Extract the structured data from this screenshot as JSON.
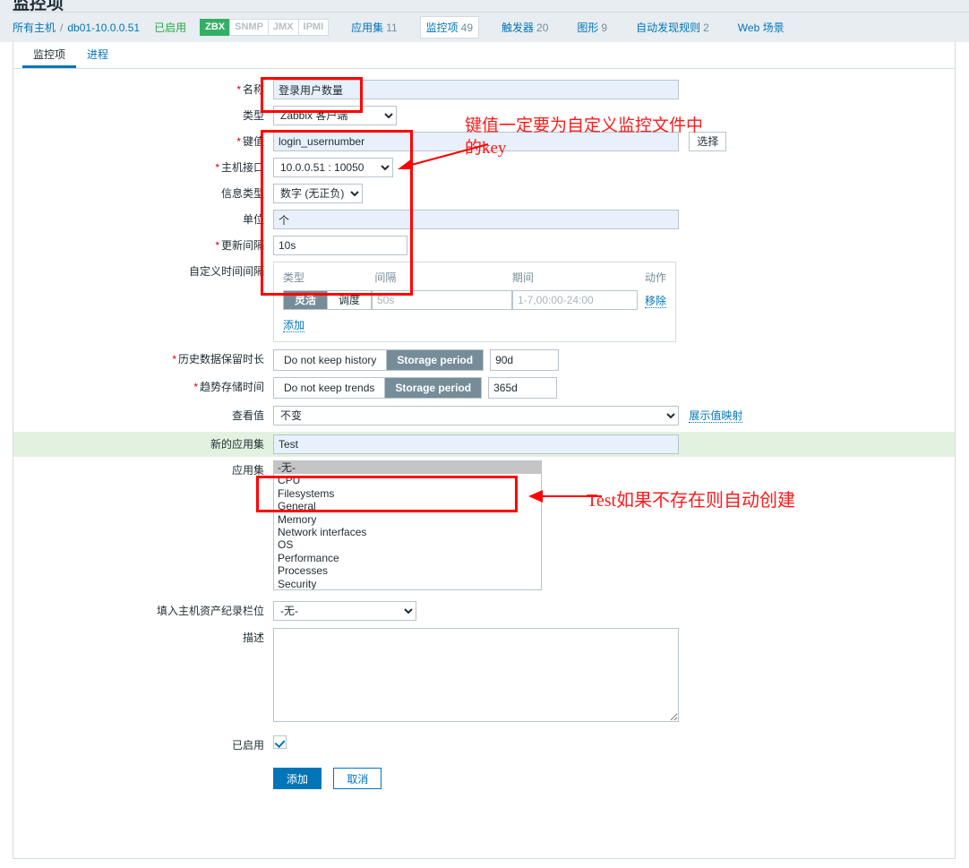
{
  "page": {
    "cut_title": "监控项"
  },
  "breadcrumb": {
    "all_hosts": "所有主机",
    "separator": "/",
    "host": "db01-10.0.0.51",
    "status": "已启用"
  },
  "interfaces": [
    {
      "label": "ZBX",
      "active": true
    },
    {
      "label": "SNMP",
      "active": false
    },
    {
      "label": "JMX",
      "active": false
    },
    {
      "label": "IPMI",
      "active": false
    }
  ],
  "entity_tabs": [
    {
      "label": "应用集",
      "count": "11",
      "selected": false
    },
    {
      "label": "监控项",
      "count": "49",
      "selected": true
    },
    {
      "label": "触发器",
      "count": "20",
      "selected": false
    },
    {
      "label": "图形",
      "count": "9",
      "selected": false
    },
    {
      "label": "自动发现规则",
      "count": "2",
      "selected": false
    },
    {
      "label": "Web 场景",
      "count": "",
      "selected": false
    }
  ],
  "tabs": [
    {
      "label": "监控项",
      "active": true
    },
    {
      "label": "进程",
      "active": false
    }
  ],
  "form": {
    "name": {
      "label": "名称",
      "required": true,
      "value": "登录用户数量"
    },
    "type": {
      "label": "类型",
      "required": false,
      "value": "Zabbix 客户端"
    },
    "key": {
      "label": "键值",
      "required": true,
      "value": "login_usernumber",
      "select_button": "选择"
    },
    "host_interface": {
      "label": "主机接口",
      "required": true,
      "value": "10.0.0.51 : 10050"
    },
    "info_type": {
      "label": "信息类型",
      "required": false,
      "value": "数字 (无正负)"
    },
    "units": {
      "label": "单位",
      "required": false,
      "value": "个"
    },
    "update_interval": {
      "label": "更新间隔",
      "required": true,
      "value": "10s"
    },
    "custom_intervals": {
      "label": "自定义时间间隔",
      "headers": {
        "type": "类型",
        "interval": "间隔",
        "period": "期间",
        "action": "动作"
      },
      "rows": [
        {
          "type_options": [
            {
              "label": "灵活",
              "selected": true
            },
            {
              "label": "调度",
              "selected": false
            }
          ],
          "interval_placeholder": "50s",
          "interval_value": "",
          "period_placeholder": "1-7,00:00-24:00",
          "period_value": "",
          "remove_label": "移除"
        }
      ],
      "add_label": "添加"
    },
    "history": {
      "label": "历史数据保留时长",
      "required": true,
      "options": [
        {
          "label": "Do not keep history",
          "selected": false
        },
        {
          "label": "Storage period",
          "selected": true
        }
      ],
      "value": "90d"
    },
    "trends": {
      "label": "趋势存储时间",
      "required": true,
      "options": [
        {
          "label": "Do not keep trends",
          "selected": false
        },
        {
          "label": "Storage period",
          "selected": true
        }
      ],
      "value": "365d"
    },
    "value_map": {
      "label": "查看值",
      "value": "不变",
      "link": "展示值映射"
    },
    "new_application": {
      "label": "新的应用集",
      "value": "Test"
    },
    "applications": {
      "label": "应用集",
      "options": [
        {
          "label": "-无-",
          "selected": true
        },
        {
          "label": "CPU",
          "selected": false
        },
        {
          "label": "Filesystems",
          "selected": false
        },
        {
          "label": "General",
          "selected": false
        },
        {
          "label": "Memory",
          "selected": false
        },
        {
          "label": "Network interfaces",
          "selected": false
        },
        {
          "label": "OS",
          "selected": false
        },
        {
          "label": "Performance",
          "selected": false
        },
        {
          "label": "Processes",
          "selected": false
        },
        {
          "label": "Security",
          "selected": false
        }
      ]
    },
    "inventory_field": {
      "label": "填入主机资产纪录栏位",
      "value": "-无-"
    },
    "description": {
      "label": "描述",
      "value": ""
    },
    "enabled": {
      "label": "已启用",
      "checked": true
    },
    "submit": "添加",
    "cancel": "取消"
  },
  "annotations": {
    "key_note": "键值一定要为自定义监控文件中\n的key",
    "app_note": "Test如果不存在则自动创建"
  },
  "colors": {
    "accent": "#0275b8",
    "annotation": "#ff0000",
    "zbx_green": "#34af67",
    "status_green": "#29a64a",
    "segment_on": "#768d99",
    "filled_field": "#e8f0fb",
    "green_row": "#e3f2e0"
  }
}
